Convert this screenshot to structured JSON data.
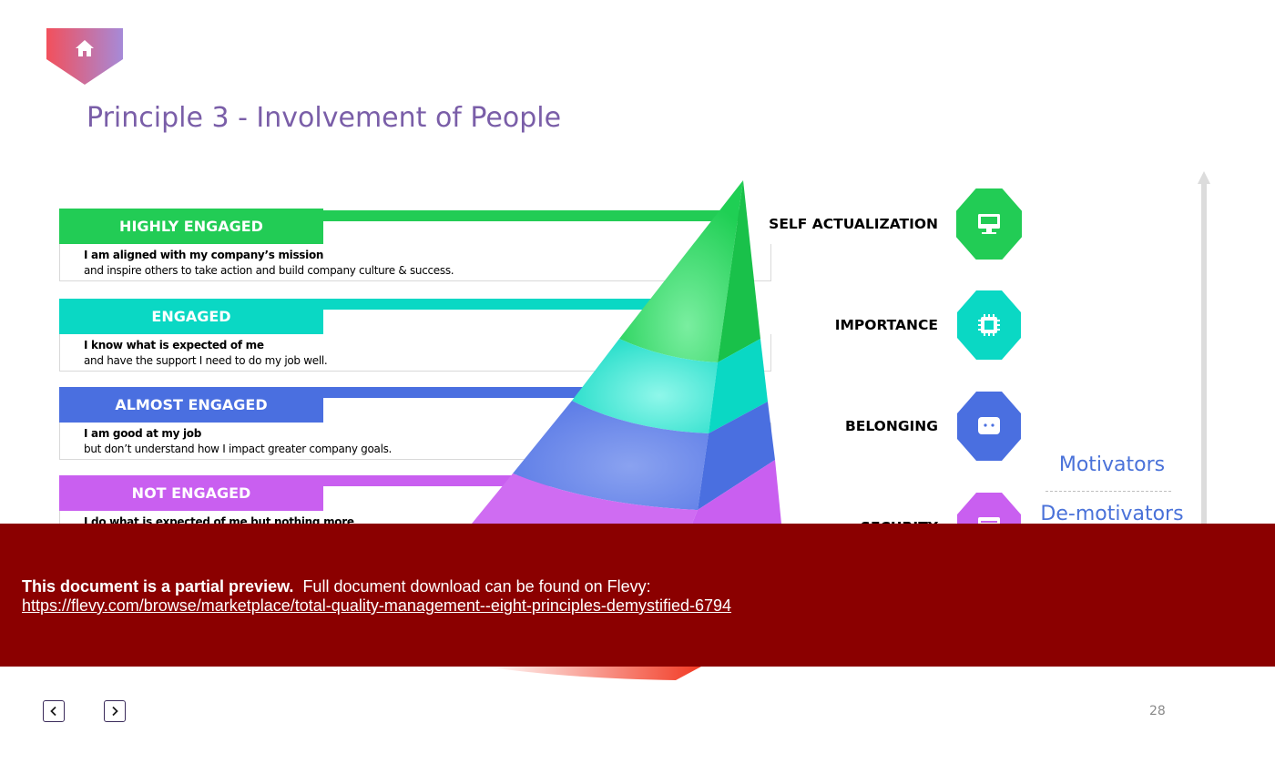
{
  "slide": {
    "title": "Principle 3 - Involvement of People",
    "page_number": "28"
  },
  "engagement_levels": [
    {
      "label": "HIGHLY ENGAGED",
      "desc_title": "I am aligned with my company’s mission",
      "desc_body": "and inspire others to take action and build company culture & success.",
      "color": "#22cc55"
    },
    {
      "label": "ENGAGED",
      "desc_title": "I know what is expected of me",
      "desc_body": "and have the support I need to do my job well.",
      "color": "#0ad8c4"
    },
    {
      "label": "ALMOST ENGAGED",
      "desc_title": "I am good at my job",
      "desc_body": "but don’t understand how I impact greater company goals.",
      "color": "#4a6fe0"
    },
    {
      "label": "NOT ENGAGED",
      "desc_title": "I do what is expected of me but nothing more",
      "desc_body": "",
      "color": "#c95ff0"
    }
  ],
  "needs": [
    {
      "label": "SELF ACTUALIZATION",
      "icon": "monitor-icon",
      "color": "#22cc55"
    },
    {
      "label": "IMPORTANCE",
      "icon": "chip-icon",
      "color": "#0ad8c4"
    },
    {
      "label": "BELONGING",
      "icon": "chat-icon",
      "color": "#4a6fe0"
    },
    {
      "label": "SECURITY",
      "icon": "list-icon",
      "color": "#c95ff0"
    }
  ],
  "scale": {
    "motivators": "Motivators",
    "demotivators": "De-motivators"
  },
  "preview_banner": {
    "bold_text": "This document is a partial preview.",
    "text": "Full document download can be found on Flevy:",
    "link": "https://flevy.com/browse/marketplace/total-quality-management--eight-principles-demystified-6794",
    "background": "#8b0000"
  },
  "nav": {
    "prev_icon": "chevron-left-icon",
    "next_icon": "chevron-right-icon"
  }
}
